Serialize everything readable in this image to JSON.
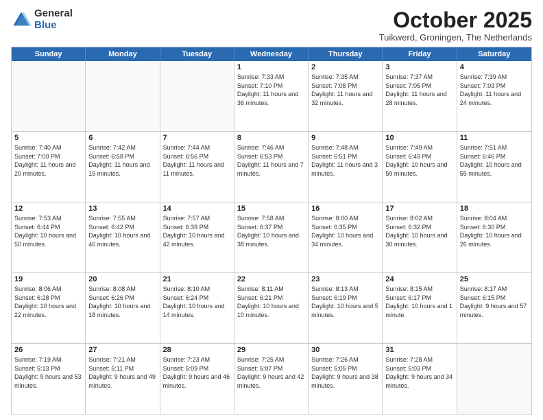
{
  "logo": {
    "general": "General",
    "blue": "Blue"
  },
  "title": "October 2025",
  "subtitle": "Tuikwerd, Groningen, The Netherlands",
  "days_of_week": [
    "Sunday",
    "Monday",
    "Tuesday",
    "Wednesday",
    "Thursday",
    "Friday",
    "Saturday"
  ],
  "weeks": [
    [
      {
        "day": "",
        "info": ""
      },
      {
        "day": "",
        "info": ""
      },
      {
        "day": "",
        "info": ""
      },
      {
        "day": "1",
        "info": "Sunrise: 7:33 AM\nSunset: 7:10 PM\nDaylight: 11 hours\nand 36 minutes."
      },
      {
        "day": "2",
        "info": "Sunrise: 7:35 AM\nSunset: 7:08 PM\nDaylight: 11 hours\nand 32 minutes."
      },
      {
        "day": "3",
        "info": "Sunrise: 7:37 AM\nSunset: 7:05 PM\nDaylight: 11 hours\nand 28 minutes."
      },
      {
        "day": "4",
        "info": "Sunrise: 7:39 AM\nSunset: 7:03 PM\nDaylight: 11 hours\nand 24 minutes."
      }
    ],
    [
      {
        "day": "5",
        "info": "Sunrise: 7:40 AM\nSunset: 7:00 PM\nDaylight: 11 hours\nand 20 minutes."
      },
      {
        "day": "6",
        "info": "Sunrise: 7:42 AM\nSunset: 6:58 PM\nDaylight: 11 hours\nand 15 minutes."
      },
      {
        "day": "7",
        "info": "Sunrise: 7:44 AM\nSunset: 6:56 PM\nDaylight: 11 hours\nand 11 minutes."
      },
      {
        "day": "8",
        "info": "Sunrise: 7:46 AM\nSunset: 6:53 PM\nDaylight: 11 hours\nand 7 minutes."
      },
      {
        "day": "9",
        "info": "Sunrise: 7:48 AM\nSunset: 6:51 PM\nDaylight: 11 hours\nand 3 minutes."
      },
      {
        "day": "10",
        "info": "Sunrise: 7:49 AM\nSunset: 6:49 PM\nDaylight: 10 hours\nand 59 minutes."
      },
      {
        "day": "11",
        "info": "Sunrise: 7:51 AM\nSunset: 6:46 PM\nDaylight: 10 hours\nand 55 minutes."
      }
    ],
    [
      {
        "day": "12",
        "info": "Sunrise: 7:53 AM\nSunset: 6:44 PM\nDaylight: 10 hours\nand 50 minutes."
      },
      {
        "day": "13",
        "info": "Sunrise: 7:55 AM\nSunset: 6:42 PM\nDaylight: 10 hours\nand 46 minutes."
      },
      {
        "day": "14",
        "info": "Sunrise: 7:57 AM\nSunset: 6:39 PM\nDaylight: 10 hours\nand 42 minutes."
      },
      {
        "day": "15",
        "info": "Sunrise: 7:58 AM\nSunset: 6:37 PM\nDaylight: 10 hours\nand 38 minutes."
      },
      {
        "day": "16",
        "info": "Sunrise: 8:00 AM\nSunset: 6:35 PM\nDaylight: 10 hours\nand 34 minutes."
      },
      {
        "day": "17",
        "info": "Sunrise: 8:02 AM\nSunset: 6:32 PM\nDaylight: 10 hours\nand 30 minutes."
      },
      {
        "day": "18",
        "info": "Sunrise: 8:04 AM\nSunset: 6:30 PM\nDaylight: 10 hours\nand 26 minutes."
      }
    ],
    [
      {
        "day": "19",
        "info": "Sunrise: 8:06 AM\nSunset: 6:28 PM\nDaylight: 10 hours\nand 22 minutes."
      },
      {
        "day": "20",
        "info": "Sunrise: 8:08 AM\nSunset: 6:26 PM\nDaylight: 10 hours\nand 18 minutes."
      },
      {
        "day": "21",
        "info": "Sunrise: 8:10 AM\nSunset: 6:24 PM\nDaylight: 10 hours\nand 14 minutes."
      },
      {
        "day": "22",
        "info": "Sunrise: 8:11 AM\nSunset: 6:21 PM\nDaylight: 10 hours\nand 10 minutes."
      },
      {
        "day": "23",
        "info": "Sunrise: 8:13 AM\nSunset: 6:19 PM\nDaylight: 10 hours\nand 5 minutes."
      },
      {
        "day": "24",
        "info": "Sunrise: 8:15 AM\nSunset: 6:17 PM\nDaylight: 10 hours\nand 1 minute."
      },
      {
        "day": "25",
        "info": "Sunrise: 8:17 AM\nSunset: 6:15 PM\nDaylight: 9 hours\nand 57 minutes."
      }
    ],
    [
      {
        "day": "26",
        "info": "Sunrise: 7:19 AM\nSunset: 5:13 PM\nDaylight: 9 hours\nand 53 minutes."
      },
      {
        "day": "27",
        "info": "Sunrise: 7:21 AM\nSunset: 5:11 PM\nDaylight: 9 hours\nand 49 minutes."
      },
      {
        "day": "28",
        "info": "Sunrise: 7:23 AM\nSunset: 5:09 PM\nDaylight: 9 hours\nand 46 minutes."
      },
      {
        "day": "29",
        "info": "Sunrise: 7:25 AM\nSunset: 5:07 PM\nDaylight: 9 hours\nand 42 minutes."
      },
      {
        "day": "30",
        "info": "Sunrise: 7:26 AM\nSunset: 5:05 PM\nDaylight: 9 hours\nand 38 minutes."
      },
      {
        "day": "31",
        "info": "Sunrise: 7:28 AM\nSunset: 5:03 PM\nDaylight: 9 hours\nand 34 minutes."
      },
      {
        "day": "",
        "info": ""
      }
    ]
  ]
}
